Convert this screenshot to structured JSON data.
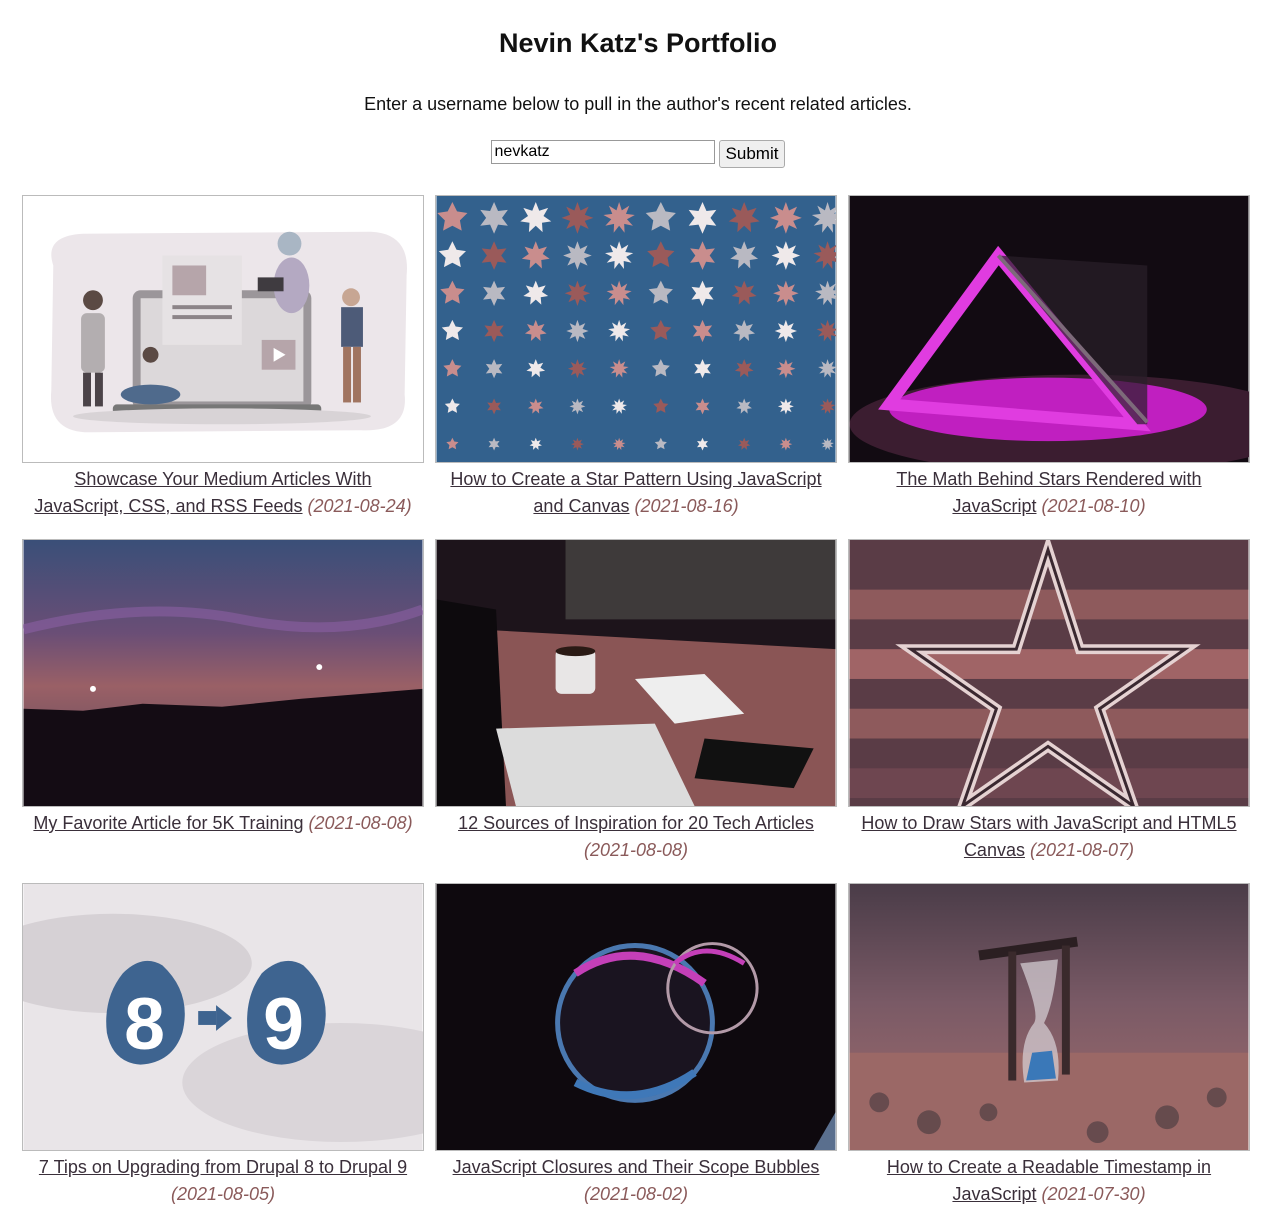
{
  "page": {
    "title": "Nevin Katz's Portfolio",
    "intro": "Enter a username below to pull in the author's recent related articles."
  },
  "form": {
    "username_value": "nevkatz",
    "submit_label": "Submit"
  },
  "articles": [
    {
      "title": "Showcase Your Medium Articles With JavaScript, CSS, and RSS Feeds",
      "date": "(2021-08-24)",
      "image": "illustration-people-laptop"
    },
    {
      "title": "How to Create a Star Pattern Using JavaScript and Canvas",
      "date": "(2021-08-16)",
      "image": "star-pattern"
    },
    {
      "title": "The Math Behind Stars Rendered with JavaScript",
      "date": "(2021-08-10)",
      "image": "glowing-triangle"
    },
    {
      "title": "My Favorite Article for 5K Training",
      "date": "(2021-08-08)",
      "image": "sunset-sky"
    },
    {
      "title": "12 Sources of Inspiration for 20 Tech Articles",
      "date": "(2021-08-08)",
      "image": "laptop-desk"
    },
    {
      "title": "How to Draw Stars with JavaScript and HTML5 Canvas",
      "date": "(2021-08-07)",
      "image": "wooden-star"
    },
    {
      "title": "7 Tips on Upgrading from Drupal 8 to Drupal 9",
      "date": "(2021-08-05)",
      "image": "drupal-8-to-9"
    },
    {
      "title": "JavaScript Closures and Their Scope Bubbles",
      "date": "(2021-08-02)",
      "image": "soap-bubbles"
    },
    {
      "title": "How to Create a Readable Timestamp in JavaScript",
      "date": "(2021-07-30)",
      "image": "hourglass"
    }
  ],
  "logo_text": {
    "drupal_from": "8",
    "drupal_to": "9"
  }
}
